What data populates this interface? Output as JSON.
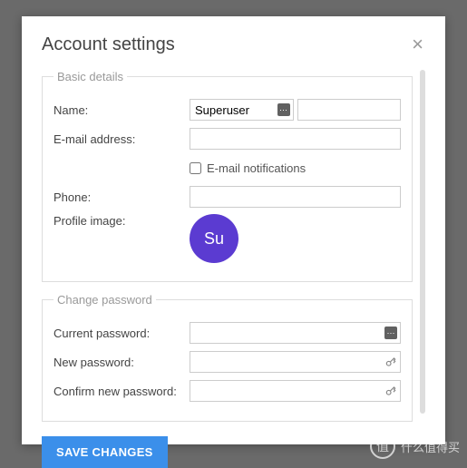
{
  "modal": {
    "title": "Account settings",
    "close": "×"
  },
  "basic": {
    "legend": "Basic details",
    "name_label": "Name:",
    "name_first": "Superuser",
    "name_last": "",
    "email_label": "E-mail address:",
    "email_value": "",
    "notif_label": "E-mail notifications",
    "phone_label": "Phone:",
    "phone_value": "",
    "profile_label": "Profile image:",
    "avatar_text": "Su"
  },
  "password": {
    "legend": "Change password",
    "current_label": "Current password:",
    "current_value": "",
    "new_label": "New password:",
    "new_value": "",
    "confirm_label": "Confirm new password:",
    "confirm_value": ""
  },
  "actions": {
    "save": "SAVE CHANGES"
  },
  "watermark": {
    "badge": "值",
    "text": "什么值得买"
  }
}
